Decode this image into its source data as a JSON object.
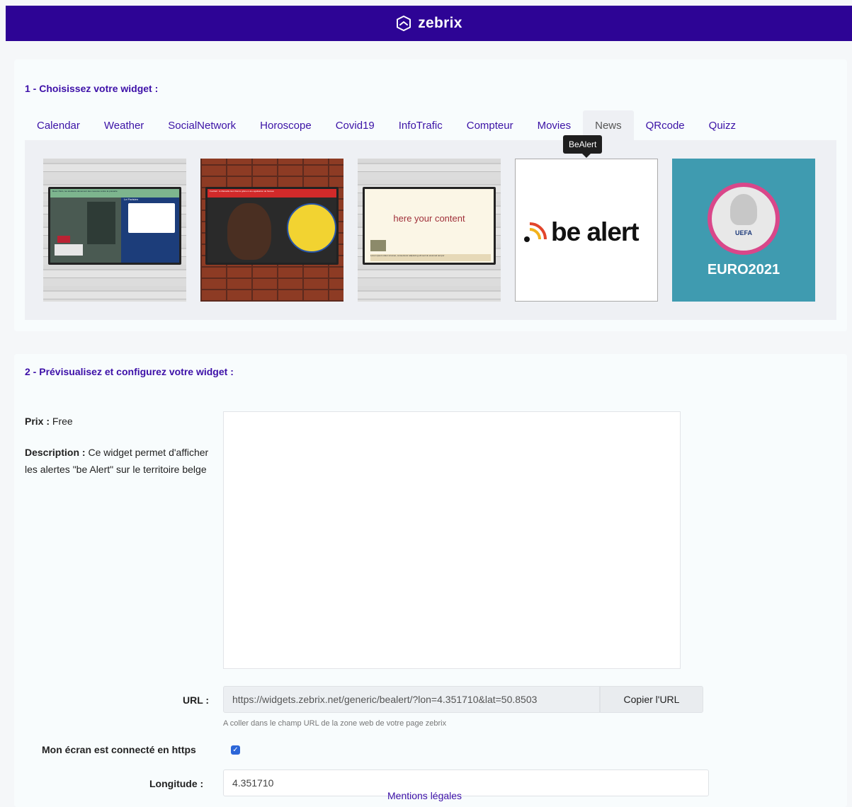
{
  "header": {
    "brand": "zebrix",
    "logo_icon": "zebrix-logo-icon",
    "bg_color": "#2d0495"
  },
  "section1": {
    "title": "1 - Choisissez votre widget :",
    "tabs": [
      "Calendar",
      "Weather",
      "SocialNetwork",
      "Horoscope",
      "Covid19",
      "InfoTrafic",
      "Compteur",
      "Movies",
      "News",
      "QRcode",
      "Quizz"
    ],
    "active_tab": "News",
    "tooltip": "BeAlert",
    "thumbnails": {
      "t1": {
        "headline": "Rees: Paris, les étudiants dénoncent des mesures contre la précarité",
        "side": "Le Parisien"
      },
      "t2": {
        "headline": "Football : le Marseille tient Reims grâce à une égalisation de Sanson"
      },
      "t3": {
        "content": "here your content",
        "ticker": "Lorem ipsum dolor sit amet, consectetur adipiscing elit sed do eiusmod tempor"
      },
      "t4": {
        "text": "be alert"
      },
      "t5": {
        "small": "UEFA",
        "text": "EURO2021"
      }
    }
  },
  "section2": {
    "title": "2 - Prévisualisez et configurez votre widget :",
    "price_label": "Prix :",
    "price_value": "Free",
    "description_label": "Description :",
    "description_value": "Ce widget permet d'afficher les alertes \"be Alert\" sur le territoire belge",
    "url_label": "URL :",
    "url_value": "https://widgets.zebrix.net/generic/bealert/?lon=4.351710&lat=50.8503",
    "copy_button": "Copier l'URL",
    "url_hint": "A coller dans le champ URL de la zone web de votre page zebrix",
    "https_label": "Mon écran est connecté en https",
    "https_checked": true,
    "longitude_label": "Longitude :",
    "longitude_value": "4.351710",
    "footer_link": "Mentions légales"
  }
}
